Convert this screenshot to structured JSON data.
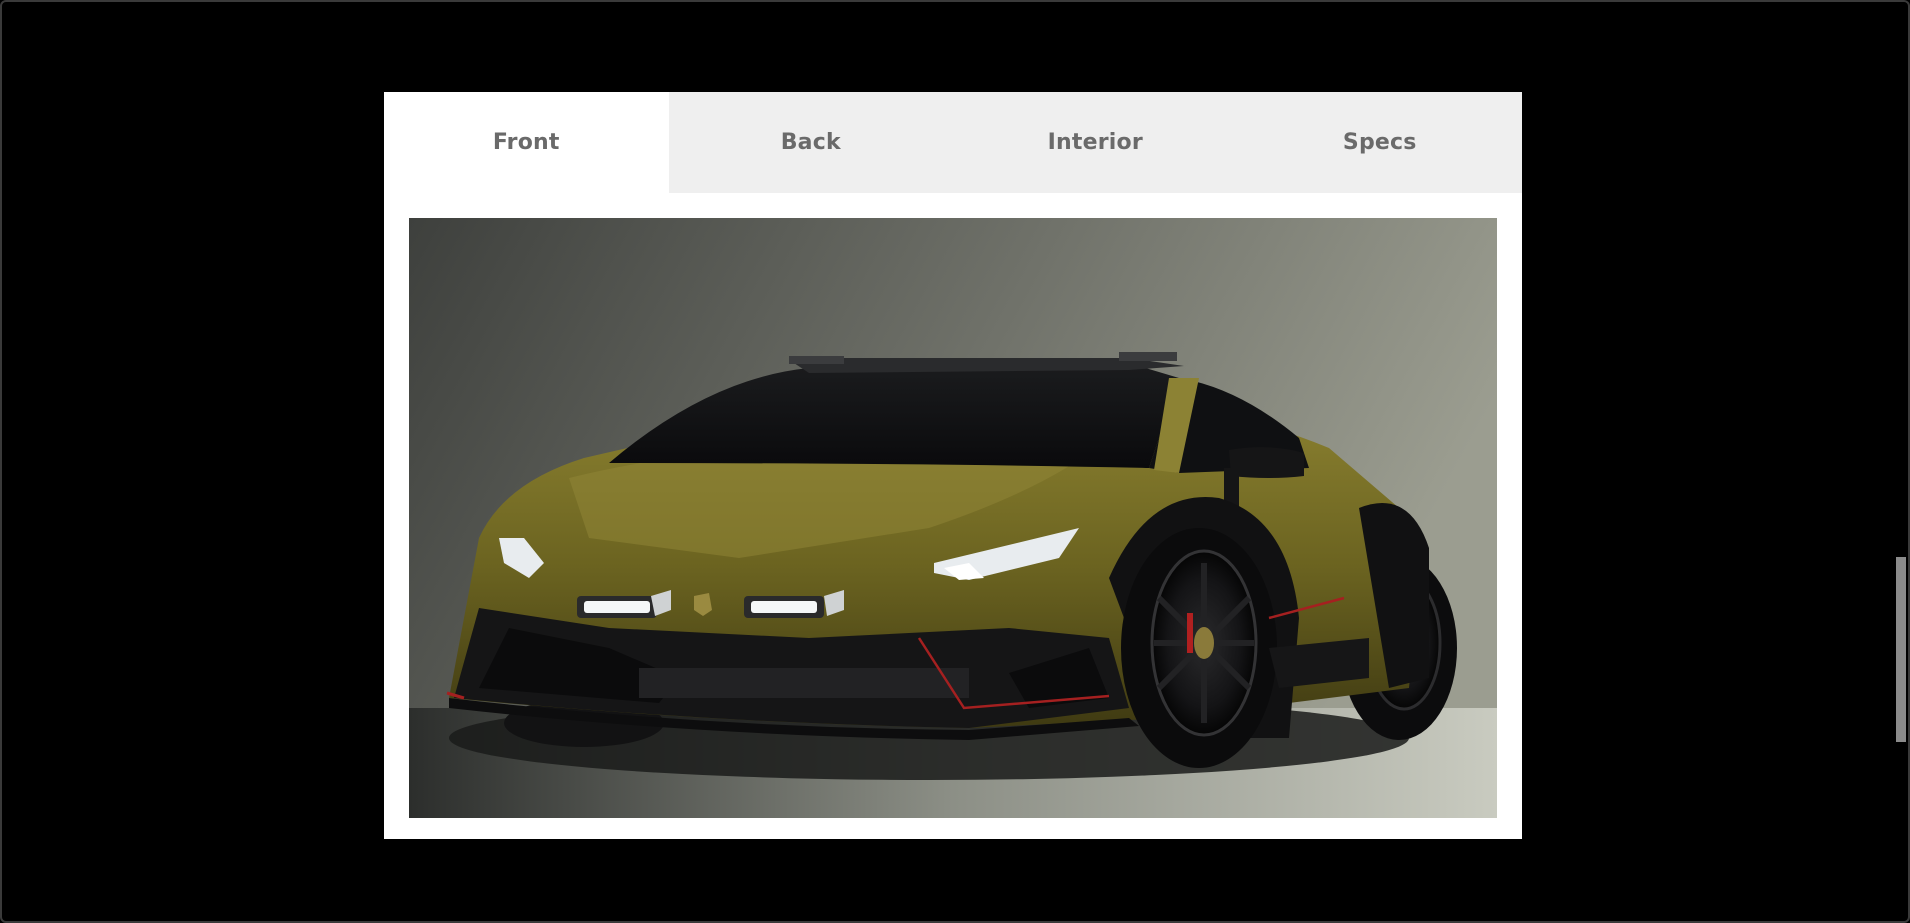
{
  "gallery": {
    "tabs": [
      {
        "label": "Front",
        "active": true
      },
      {
        "label": "Back",
        "active": false
      },
      {
        "label": "Interior",
        "active": false
      },
      {
        "label": "Specs",
        "active": false
      }
    ],
    "image": {
      "subject": "front three-quarter view of olive green sports car with black wheel arches in studio"
    }
  },
  "colors": {
    "page_background": "#000000",
    "tab_inactive": "#efefef",
    "tab_active": "#ffffff",
    "tab_text": "#6a6a6a",
    "car_body": "#6b6320",
    "studio_wall": "#7d7f74"
  }
}
